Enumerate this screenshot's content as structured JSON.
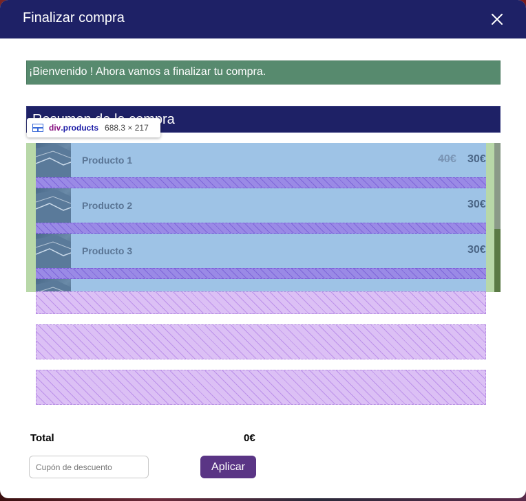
{
  "modal": {
    "title": "Finalizar compra",
    "close_icon": "close-icon"
  },
  "welcome": {
    "message": "¡Bienvenido ! Ahora vamos a finalizar tu compra."
  },
  "summary": {
    "heading": "Resumen de la compra"
  },
  "products": [
    {
      "name": "Producto 1",
      "old_price": "40€",
      "price": "30€"
    },
    {
      "name": "Producto 2",
      "old_price": "",
      "price": "30€"
    },
    {
      "name": "Producto 3",
      "old_price": "",
      "price": "30€"
    },
    {
      "name": "",
      "old_price": "",
      "price": ""
    }
  ],
  "inspector": {
    "tag": "div",
    "class": ".products",
    "dimensions": "688.3 × 217",
    "icon": "grid-layout-icon"
  },
  "totals": {
    "label": "Total",
    "value": "0€"
  },
  "coupon": {
    "placeholder": "Cupón de descuento",
    "value": "",
    "apply_label": "Aplicar"
  },
  "colors": {
    "header_bg": "#1e2166",
    "welcome_bg": "#578a6e",
    "apply_bg": "#5a3585",
    "product_bg": "#9ec3e6",
    "overlay_purple": "#dcc0f5"
  }
}
